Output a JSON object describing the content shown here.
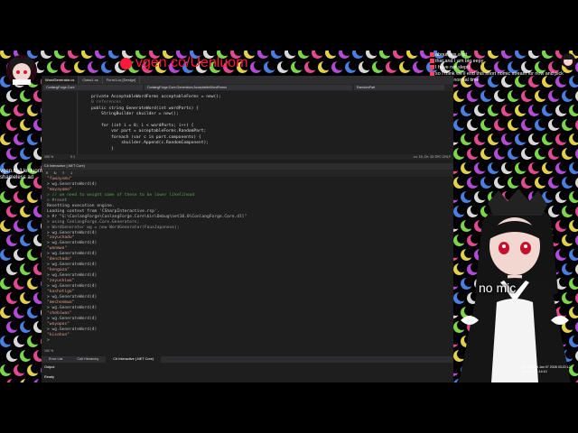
{
  "banner": {
    "url_text": "vgen.co/Uenluom",
    "accent": "#ff1a3c"
  },
  "chat": {
    "lines": [
      {
        "user": "",
        "text": "about this a bit"
      },
      {
        "user": "",
        "text": "that and I am big eepy"
      },
      {
        "user": "",
        "text": "I have not slept)"
      },
      {
        "user": "",
        "text": "so I think we'll end this short nomic stream for now and pick back up at normal time"
      }
    ]
  },
  "ide": {
    "doc_tabs": [
      "WordGenerator.cs",
      "Class1.cs",
      "Form1.cs [Design]"
    ],
    "nav": [
      "ConlangForge.Core",
      "ConlangForge.Core.Generators.AcceptableWordForms",
      "RandomPart"
    ],
    "code": [
      {
        "text": "private AcceptableWordForms acceptableForms = new();",
        "cls": ""
      },
      {
        "text": "0 references",
        "cls": "dim"
      },
      {
        "text": "public string GenerateWord(int wordParts) {",
        "cls": ""
      },
      {
        "text": "    StringBuilder sbuilder = new();",
        "cls": ""
      },
      {
        "text": "",
        "cls": ""
      },
      {
        "text": "    for (int i = 0; i < wordParts; i++) {",
        "cls": ""
      },
      {
        "text": "        var part = acceptableForms.RandomPart;",
        "cls": ""
      },
      {
        "text": "        foreach (var c in part.components) {",
        "cls": ""
      },
      {
        "text": "            sbuilder.Append(c.RandomComponent);",
        "cls": ""
      },
      {
        "text": "        }",
        "cls": ""
      }
    ],
    "status": {
      "zoom": "100 %",
      "issues": "0   1",
      "position": "Ln: 15, Ch: 33   SPC   CRLF"
    },
    "interactive_title": "C# Interactive (.NET Core)",
    "repl": [
      {
        "text": "\"fuwaysmu\"",
        "cls": "str"
      },
      {
        "text": "> wg.GenerateWord(4)",
        "cls": "cmd"
      },
      {
        "text": "\"moyayomo\"",
        "cls": "str"
      },
      {
        "text": "> // we need to weight some of these to be lower likelihood",
        "cls": "com"
      },
      {
        "text": "> #reset",
        "cls": "dir"
      },
      {
        "text": "Resetting execution engine.",
        "cls": "act"
      },
      {
        "text": "Loading context from 'CSharpInteractive.rsp'.",
        "cls": "act"
      },
      {
        "text": "> #r \"G:\\ConlangForge\\ConlangForge.Core\\bin\\Debug\\net10.0\\ConlangForge.Core.dll\"",
        "cls": "cmd"
      },
      {
        "text": "> using ConlangForge.Core.Generators;",
        "cls": "dir"
      },
      {
        "text": "> WordGenerator wg = new WordGenerator(FauxJapanese);",
        "cls": "dir"
      },
      {
        "text": "> wg.GenerateWord(4)",
        "cls": "cmd"
      },
      {
        "text": "\"zoyuchadu\"",
        "cls": "str"
      },
      {
        "text": "> wg.GenerateWord(4)",
        "cls": "cmd"
      },
      {
        "text": "\"wanmwo\"",
        "cls": "str"
      },
      {
        "text": "> wg.GenerateWord(4)",
        "cls": "cmd"
      },
      {
        "text": "\"denchado\"",
        "cls": "str"
      },
      {
        "text": "> wg.GenerateWord(4)",
        "cls": "cmd"
      },
      {
        "text": "\"hengaza\"",
        "cls": "str"
      },
      {
        "text": "> wg.GenerateWord(4)",
        "cls": "cmd"
      },
      {
        "text": "\"zoyushiwo\"",
        "cls": "str"
      },
      {
        "text": "> wg.GenerateWord(4)",
        "cls": "cmd"
      },
      {
        "text": "\"kashotigo\"",
        "cls": "str"
      },
      {
        "text": "> wg.GenerateWord(4)",
        "cls": "cmd"
      },
      {
        "text": "\"mechenmwo\"",
        "cls": "str"
      },
      {
        "text": "> wg.GenerateWord(4)",
        "cls": "cmd"
      },
      {
        "text": "\"shebiwas\"",
        "cls": "str"
      },
      {
        "text": "> wg.GenerateWord(4)",
        "cls": "cmd"
      },
      {
        "text": "\"woyopos\"",
        "cls": "str"
      },
      {
        "text": "> wg.GenerateWord(4)",
        "cls": "cmd"
      },
      {
        "text": "\"kisohun\"",
        "cls": "str"
      },
      {
        "text": ">",
        "cls": "cmd"
      }
    ],
    "repl_zoom": "100 %",
    "bottom_tabs": [
      "Error List",
      "Call Hierarchy",
      "C# Interactive (.NET Core)"
    ],
    "output_label": "Output",
    "ready_label": "Ready"
  },
  "side_label": {
    "line1": "vgen.co/Uenluom",
    "line2": "shameless ad"
  },
  "overlay": {
    "no_mic": "no mic"
  },
  "clock": {
    "line1": "Earth: Wed Jan 07 2026 03:22:12",
    "line2": "Stream: 01:14:10"
  }
}
